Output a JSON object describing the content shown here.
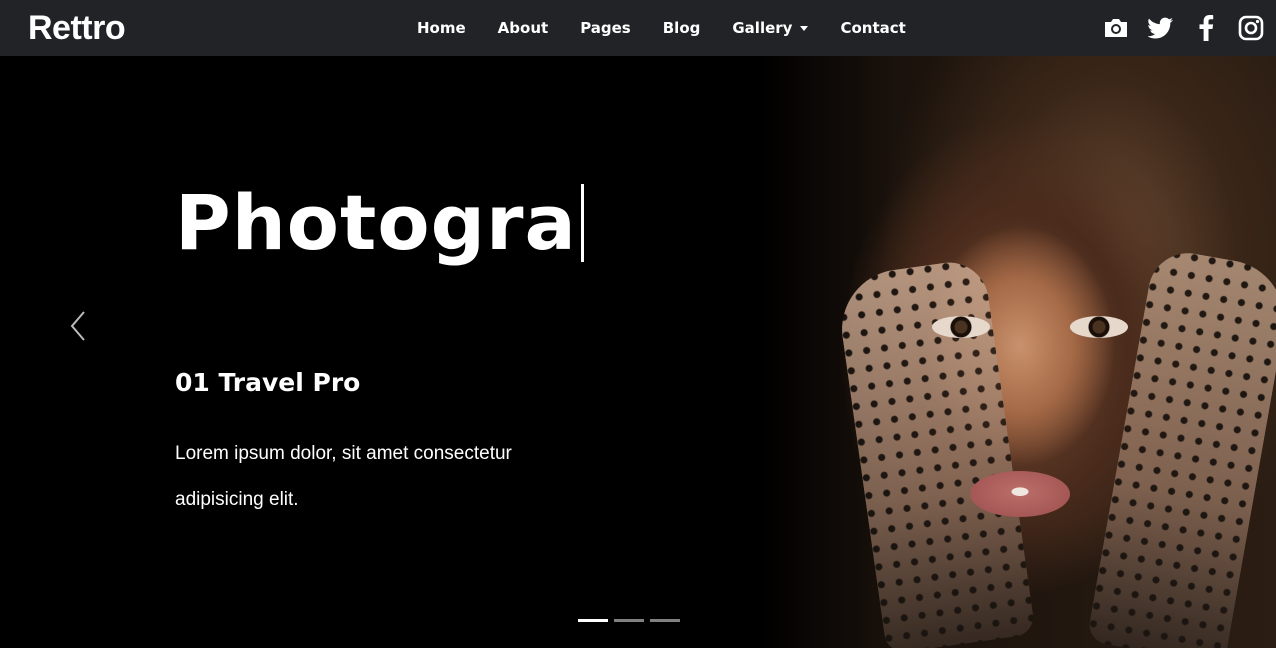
{
  "brand": "Rettro",
  "nav": {
    "items": [
      "Home",
      "About",
      "Pages",
      "Blog",
      "Gallery",
      "Contact"
    ]
  },
  "social_icons": [
    "camera-icon",
    "twitter-icon",
    "facebook-icon",
    "instagram-icon"
  ],
  "hero": {
    "headline": "Photogra",
    "slide_title": "01 Travel Pro",
    "description_line1": "Lorem ipsum dolor, sit amet consectetur",
    "description_line2": "adipisicing elit."
  },
  "carousel": {
    "slide_count": 3,
    "active_index": 0
  },
  "colors": {
    "navbar_bg": "#212327",
    "hero_bg": "#000000",
    "text": "#ffffff"
  }
}
